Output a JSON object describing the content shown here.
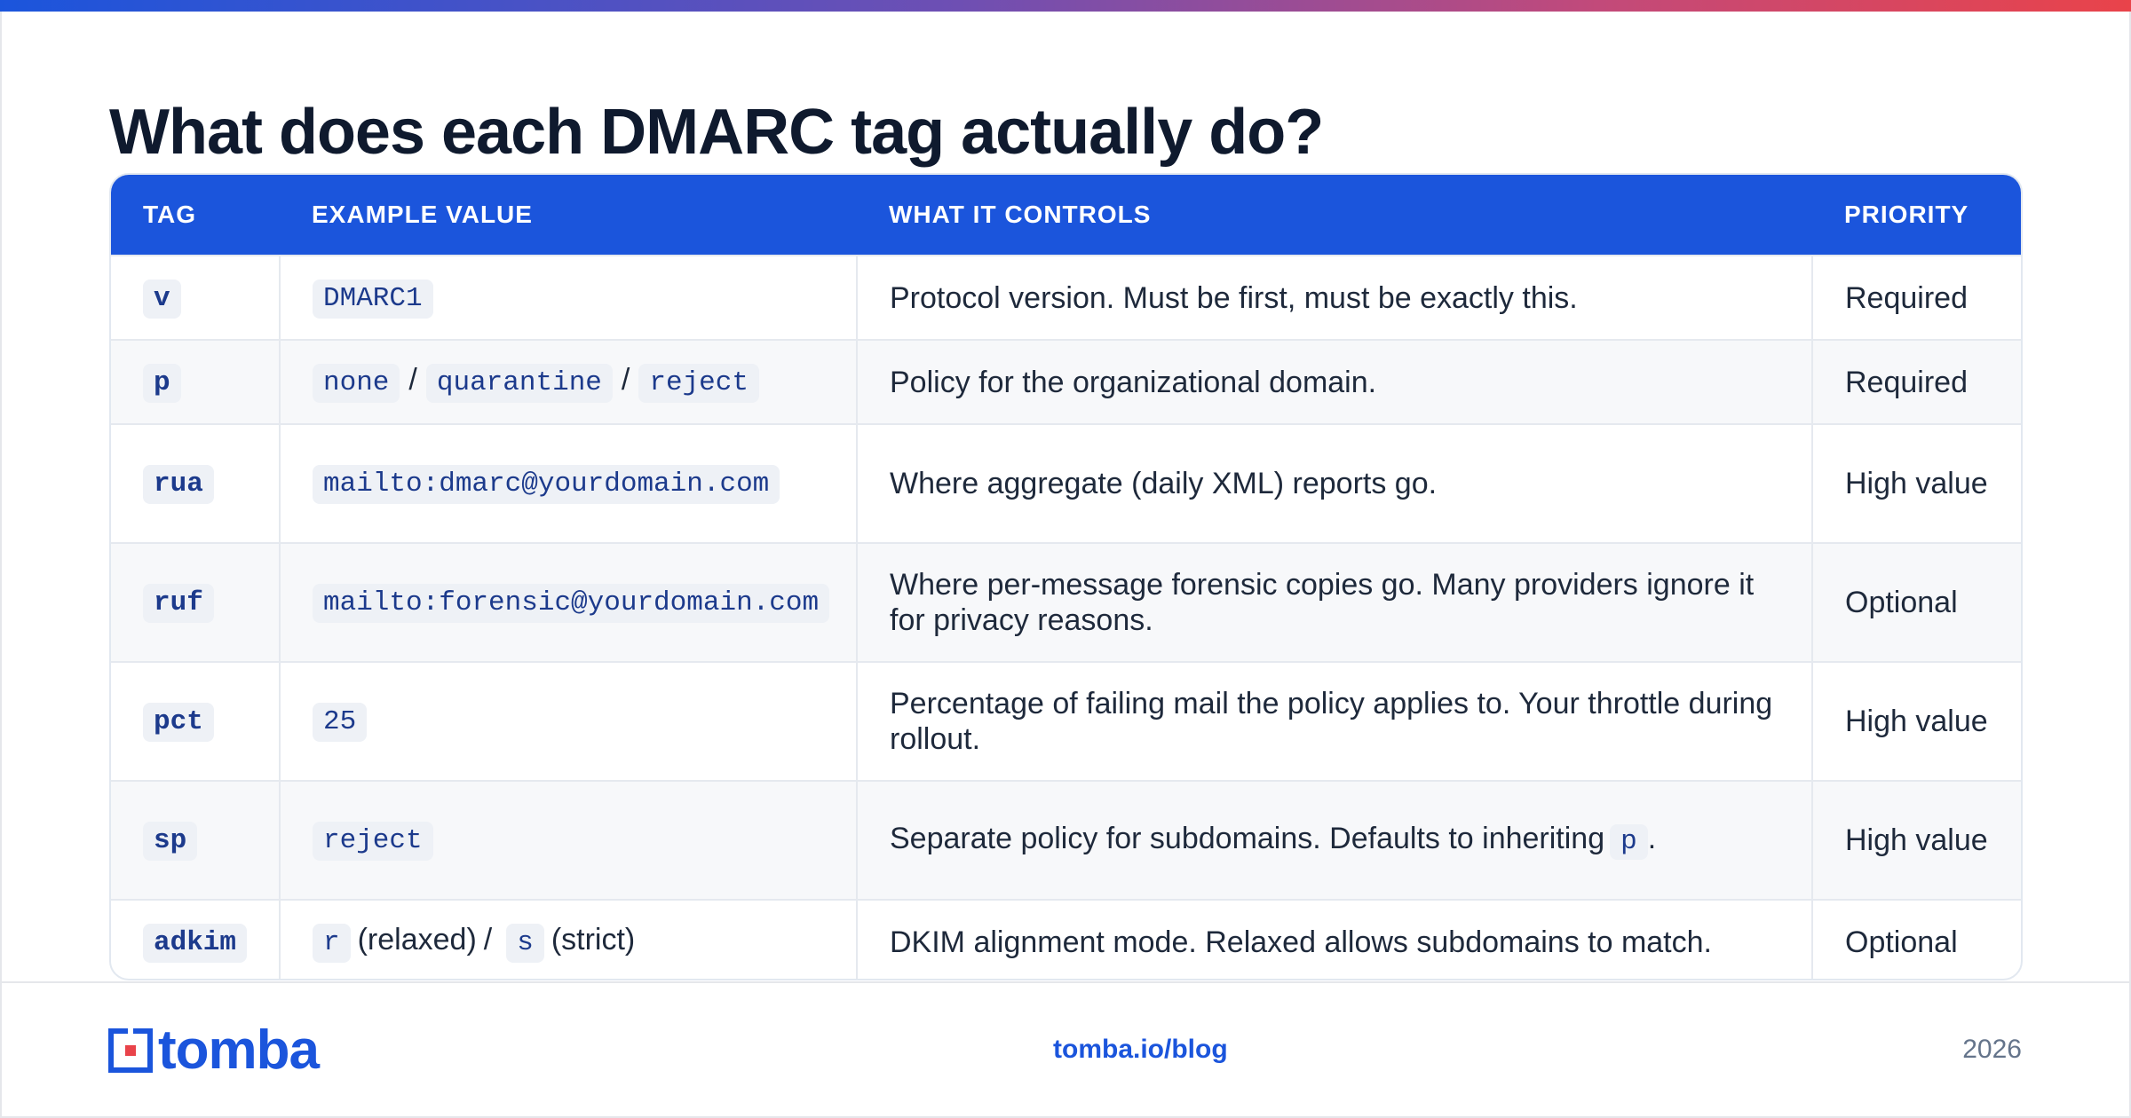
{
  "title": "What does each DMARC tag actually do?",
  "colors": {
    "accent": "#1b55dc",
    "gradient_end": "#e9434a",
    "code_text": "#1c3a8c",
    "code_bg": "#eef1f6"
  },
  "table": {
    "headers": [
      "TAG",
      "EXAMPLE VALUE",
      "WHAT IT CONTROLS",
      "PRIORITY"
    ],
    "rows": [
      {
        "tag": "v",
        "values": [
          "DMARC1"
        ],
        "controls": "Protocol version. Must be first, must be exactly this.",
        "priority": "Required"
      },
      {
        "tag": "p",
        "values": [
          "none",
          "quarantine",
          "reject"
        ],
        "separator": "/",
        "controls": "Policy for the organizational domain.",
        "priority": "Required"
      },
      {
        "tag": "rua",
        "values": [
          "mailto:dmarc@yourdomain.com"
        ],
        "controls": "Where aggregate (daily XML) reports go.",
        "priority": "High value"
      },
      {
        "tag": "ruf",
        "values": [
          "mailto:forensic@yourdomain.com"
        ],
        "controls": "Where per-message forensic copies go. Many providers ignore it for privacy reasons.",
        "priority": "Optional"
      },
      {
        "tag": "pct",
        "values": [
          "25"
        ],
        "controls": "Percentage of failing mail the policy applies to. Your throttle during rollout.",
        "priority": "High value"
      },
      {
        "tag": "sp",
        "values": [
          "reject"
        ],
        "controls_before": "Separate policy for subdomains. Defaults to inheriting",
        "controls_code": "p",
        "controls_after": ".",
        "priority": "High value"
      },
      {
        "tag": "adkim",
        "value_r": "r",
        "value_r_note": "(relaxed)",
        "value_sep": "/",
        "value_s": "s",
        "value_s_note": "(strict)",
        "controls": "DKIM alignment mode. Relaxed allows subdomains to match.",
        "priority": "Optional"
      }
    ]
  },
  "footer": {
    "logo_text": "tomba",
    "link": "tomba.io/blog",
    "year": "2026"
  }
}
